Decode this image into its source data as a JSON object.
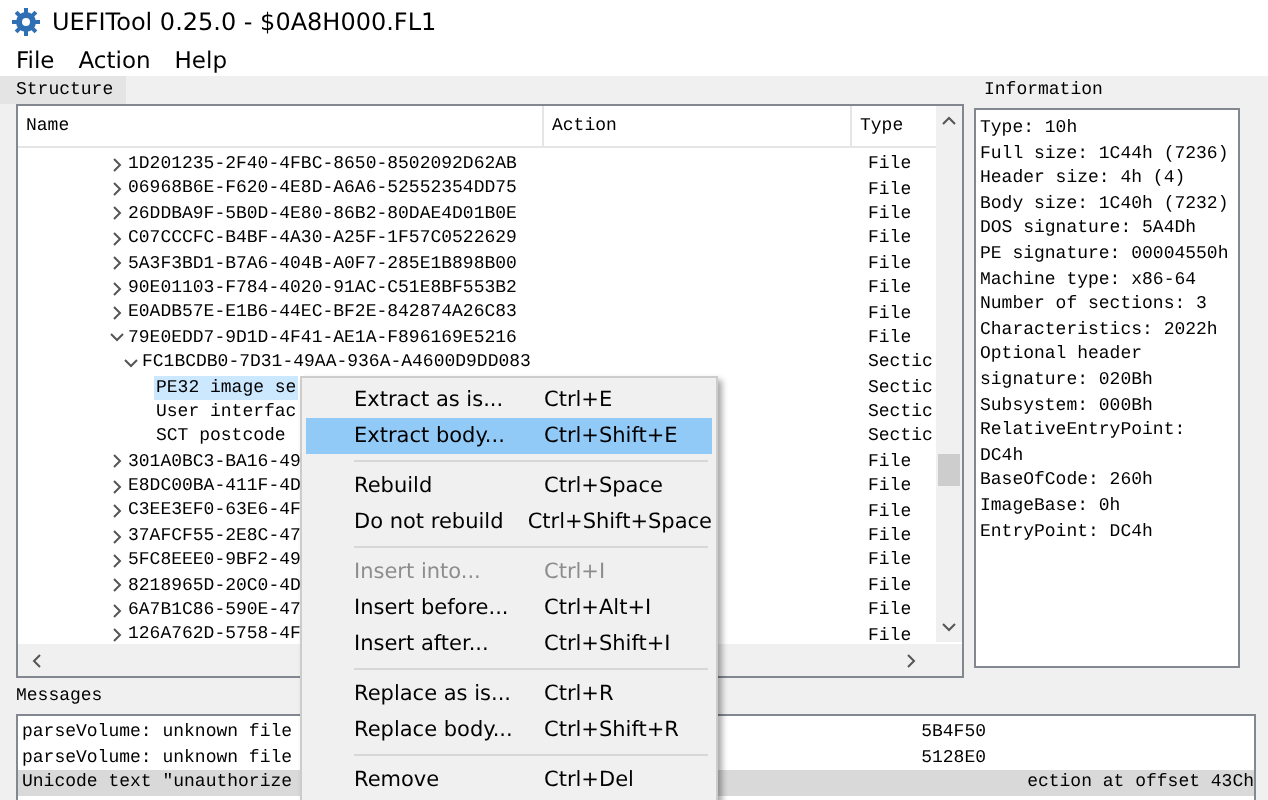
{
  "window": {
    "title": "UEFITool 0.25.0 - $0A8H000.FL1"
  },
  "menu_bar": [
    "File",
    "Action",
    "Help"
  ],
  "structure": {
    "title": "Structure",
    "columns": [
      "Name",
      "Action",
      "Type"
    ],
    "rows": [
      {
        "name": "1D201235-2F40-4FBC-8650-8502092D62AB",
        "type": "File",
        "expanded": false,
        "selected": false
      },
      {
        "name": "06968B6E-F620-4E8D-A6A6-52552354DD75",
        "type": "File",
        "expanded": false,
        "selected": false
      },
      {
        "name": "26DDBA9F-5B0D-4E80-86B2-80DAE4D01B0E",
        "type": "File",
        "expanded": false,
        "selected": false
      },
      {
        "name": "C07CCCFC-B4BF-4A30-A25F-1F57C0522629",
        "type": "File",
        "expanded": false,
        "selected": false
      },
      {
        "name": "5A3F3BD1-B7A6-404B-A0F7-285E1B898B00",
        "type": "File",
        "expanded": false,
        "selected": false
      },
      {
        "name": "90E01103-F784-4020-91AC-C51E8BF553B2",
        "type": "File",
        "expanded": false,
        "selected": false
      },
      {
        "name": "E0ADB57E-E1B6-44EC-BF2E-842874A26C83",
        "type": "File",
        "expanded": false,
        "selected": false
      },
      {
        "name": "79E0EDD7-9D1D-4F41-AE1A-F896169E5216",
        "type": "File",
        "expanded": true,
        "selected": false,
        "children": [
          {
            "name": "FC1BCDB0-7D31-49AA-936A-A4600D9DD083",
            "type": "Sectic",
            "expanded": true,
            "selected": false,
            "children": [
              {
                "name": "PE32 image se",
                "type": "Sectic",
                "selected": true
              },
              {
                "name": "User interfac",
                "type": "Sectic",
                "selected": false
              },
              {
                "name": "SCT postcode",
                "type": "Sectic",
                "selected": false
              }
            ]
          }
        ]
      },
      {
        "name": "301A0BC3-BA16-49",
        "type": "File",
        "expanded": false,
        "selected": false
      },
      {
        "name": "E8DC00BA-411F-4D",
        "type": "File",
        "expanded": false,
        "selected": false
      },
      {
        "name": "C3EE3EF0-63E6-4F",
        "type": "File",
        "expanded": false,
        "selected": false
      },
      {
        "name": "37AFCF55-2E8C-47",
        "type": "File",
        "expanded": false,
        "selected": false
      },
      {
        "name": "5FC8EEE0-9BF2-49",
        "type": "File",
        "expanded": false,
        "selected": false
      },
      {
        "name": "8218965D-20C0-4D",
        "type": "File",
        "expanded": false,
        "selected": false
      },
      {
        "name": "6A7B1C86-590E-47",
        "type": "File",
        "expanded": false,
        "selected": false
      },
      {
        "name": "126A762D-5758-4F",
        "type": "File",
        "expanded": false,
        "selected": false
      }
    ]
  },
  "information": {
    "title": "Information",
    "lines": [
      "Type: 10h",
      "Full size: 1C44h (7236)",
      "Header size: 4h (4)",
      "Body size: 1C40h (7232)",
      "DOS signature: 5A4Dh",
      "PE signature: 00004550h",
      "Machine type: x86-64",
      "Number of sections: 3",
      "Characteristics: 2022h",
      "Optional header",
      "signature: 020Bh",
      "Subsystem: 000Bh",
      "RelativeEntryPoint:",
      "DC4h",
      "BaseOfCode: 260h",
      "ImageBase: 0h",
      "EntryPoint: DC4h"
    ]
  },
  "messages": {
    "title": "Messages",
    "lines": [
      {
        "start": "parseVolume: unknown file",
        "end": "5B4F50",
        "selected": false
      },
      {
        "start": "parseVolume: unknown file",
        "end": "5128E0",
        "selected": false
      },
      {
        "start": "Unicode text \"unauthorize",
        "end": "ection at offset 43Ch",
        "selected": true
      }
    ]
  },
  "context_menu": {
    "items": [
      {
        "kind": "item",
        "label": "Extract as is...",
        "shortcut": "Ctrl+E",
        "highlighted": false,
        "disabled": false
      },
      {
        "kind": "item",
        "label": "Extract body...",
        "shortcut": "Ctrl+Shift+E",
        "highlighted": true,
        "disabled": false
      },
      {
        "kind": "separator"
      },
      {
        "kind": "item",
        "label": "Rebuild",
        "shortcut": "Ctrl+Space",
        "highlighted": false,
        "disabled": false
      },
      {
        "kind": "item",
        "label": "Do not rebuild",
        "shortcut": "Ctrl+Shift+Space",
        "highlighted": false,
        "disabled": false
      },
      {
        "kind": "separator"
      },
      {
        "kind": "item",
        "label": "Insert into...",
        "shortcut": "Ctrl+I",
        "highlighted": false,
        "disabled": true
      },
      {
        "kind": "item",
        "label": "Insert before...",
        "shortcut": "Ctrl+Alt+I",
        "highlighted": false,
        "disabled": false
      },
      {
        "kind": "item",
        "label": "Insert after...",
        "shortcut": "Ctrl+Shift+I",
        "highlighted": false,
        "disabled": false
      },
      {
        "kind": "separator"
      },
      {
        "kind": "item",
        "label": "Replace as is...",
        "shortcut": "Ctrl+R",
        "highlighted": false,
        "disabled": false
      },
      {
        "kind": "item",
        "label": "Replace body...",
        "shortcut": "Ctrl+Shift+R",
        "highlighted": false,
        "disabled": false
      },
      {
        "kind": "separator"
      },
      {
        "kind": "item",
        "label": "Remove",
        "shortcut": "Ctrl+Del",
        "highlighted": false,
        "disabled": false
      }
    ]
  }
}
